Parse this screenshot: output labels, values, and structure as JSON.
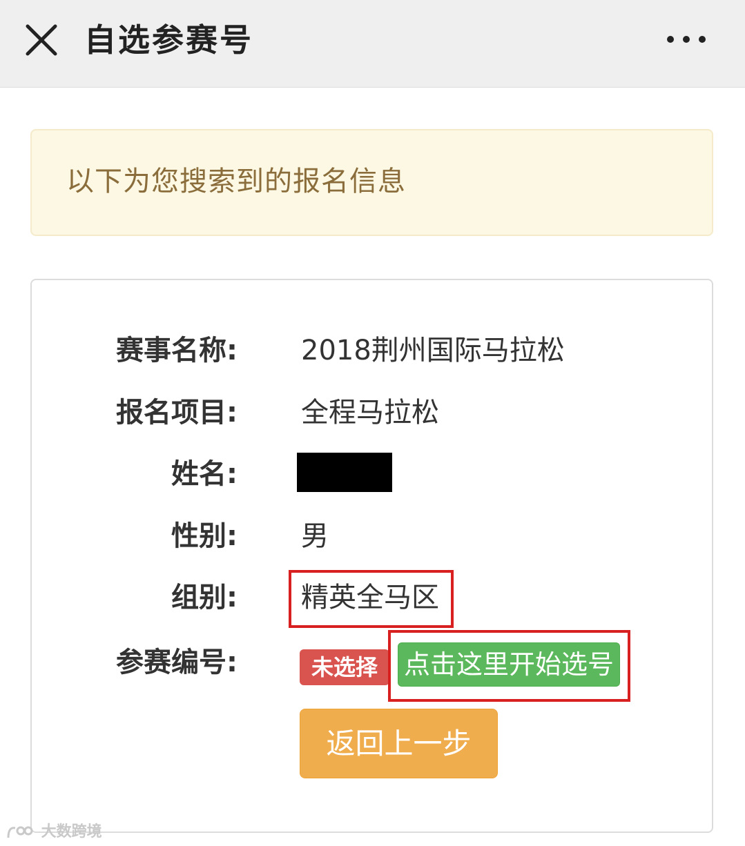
{
  "header": {
    "title": "自选参赛号",
    "close_icon": "close-icon",
    "more_icon": "more-dots-icon"
  },
  "notice": {
    "text": "以下为您搜索到的报名信息"
  },
  "info": {
    "event_name_label": "赛事名称:",
    "event_name_value": "2018荆州国际马拉松",
    "item_label": "报名项目:",
    "item_value": "全程马拉松",
    "name_label": "姓名:",
    "gender_label": "性别:",
    "gender_value": "男",
    "group_label": "组别:",
    "group_value": "精英全马区",
    "bib_label": "参赛编号:",
    "bib_status": "未选择"
  },
  "actions": {
    "start_select": "点击这里开始选号",
    "back": "返回上一步"
  },
  "watermark": {
    "text": "大数跨境"
  },
  "colors": {
    "header_bg": "#efefef",
    "notice_bg": "#fcf8e3",
    "notice_text": "#8a6d3b",
    "danger": "#d9534f",
    "success": "#5cb85c",
    "warning": "#f0ad4e",
    "highlight": "#d7201f"
  }
}
